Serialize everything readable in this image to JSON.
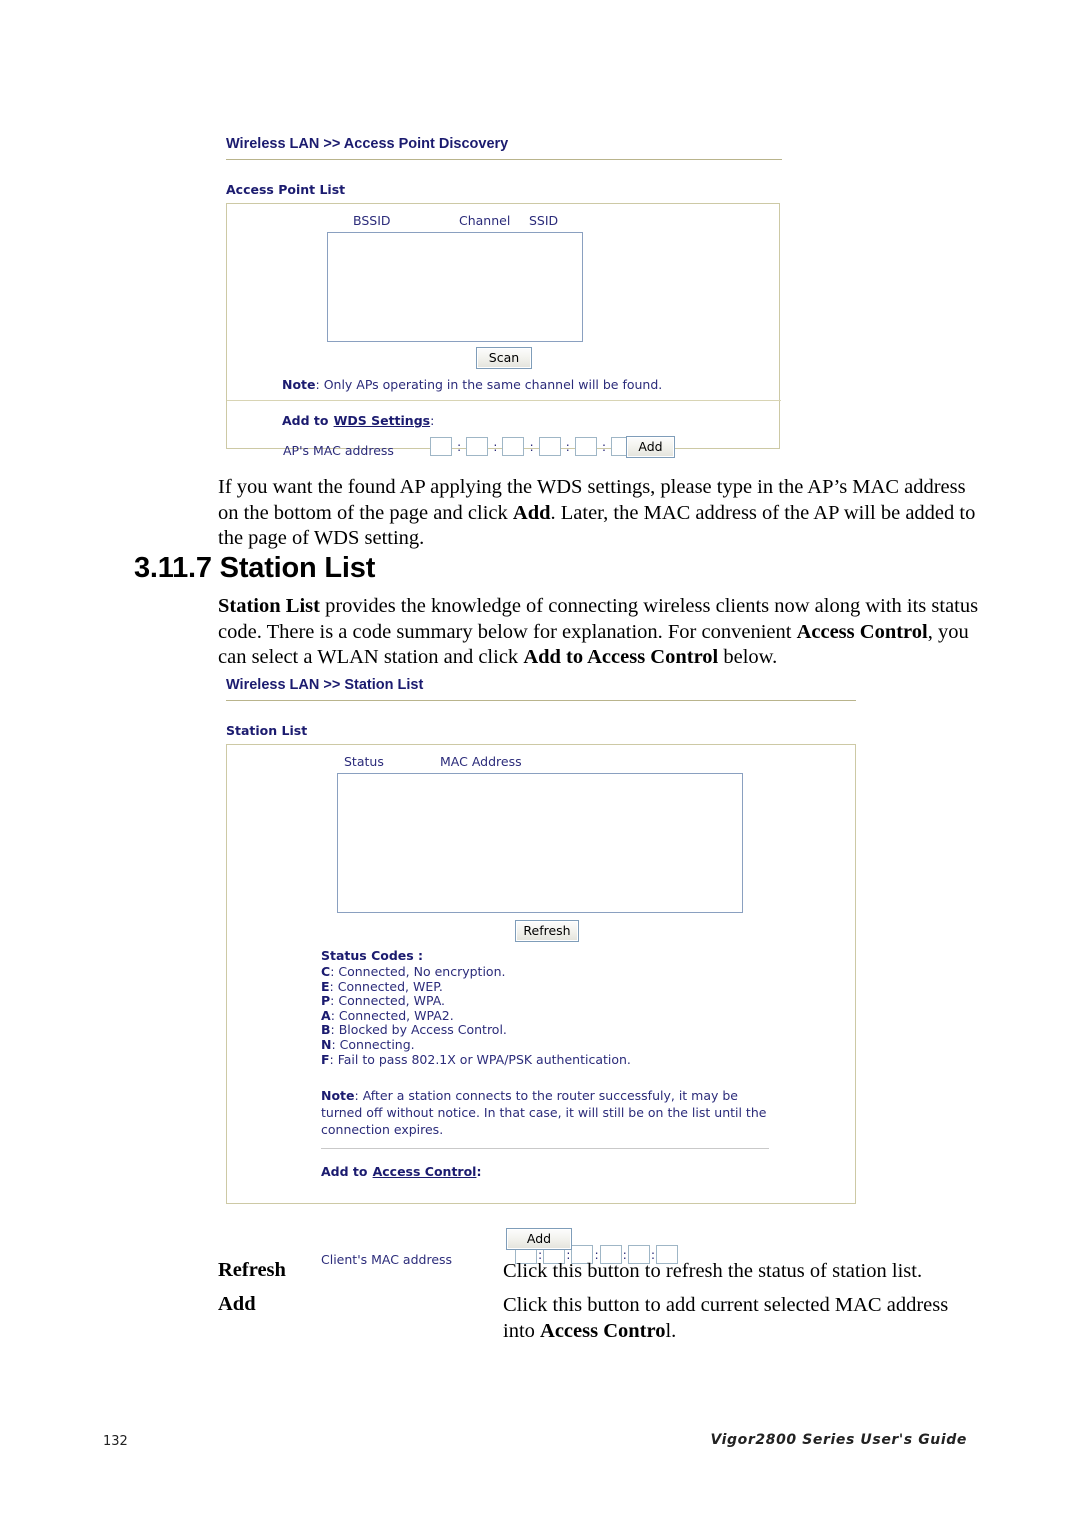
{
  "page": {
    "number": "132",
    "footer_right": "Vigor2800 Series User's Guide"
  },
  "apd_panel": {
    "title": "Wireless LAN >> Access Point Discovery",
    "section_label": "Access Point List",
    "columns": [
      "BSSID",
      "Channel",
      "SSID"
    ],
    "rows": [],
    "scan_button": "Scan",
    "note_prefix": "Note",
    "note_text": ": Only APs operating in the same channel will be found.",
    "add_to_label": "Add to",
    "add_to_link": "WDS Settings",
    "add_to_colon": ":",
    "mac_label": "AP's MAC address",
    "mac_octets": [
      "",
      "",
      "",
      "",
      "",
      ""
    ],
    "mac_separator": ":",
    "add_button": "Add"
  },
  "para_wds": {
    "line1_a": "If you want the found AP applying the WDS settings, please type in the AP’s MAC address",
    "line2_a": "on the bottom of the page and click ",
    "line2_b": "Add",
    "line2_c": ". Later, the MAC address of the AP will be added to",
    "line3_a": "the page of WDS setting."
  },
  "heading": {
    "number": "3.11.7",
    "text": "Station List",
    "full": "3.11.7 Station List"
  },
  "para_station": {
    "b1": "Station List",
    "t1": " provides the knowledge of connecting wireless clients now along with its status",
    "t2": "code. There is a code summary below for explanation. For convenient ",
    "b2": "Access Control",
    "t3": ", you",
    "t4": "can select a WLAN station and click ",
    "b3": "Add to Access Control",
    "t5": " below."
  },
  "station_panel": {
    "title": "Wireless LAN >> Station List",
    "section_label": "Station List",
    "columns": [
      "Status",
      "MAC Address"
    ],
    "rows": [],
    "refresh_button": "Refresh",
    "status_codes_title": "Status Codes :",
    "status_codes": [
      {
        "code": "C",
        "desc": ": Connected, No encryption."
      },
      {
        "code": "E",
        "desc": ": Connected, WEP."
      },
      {
        "code": "P",
        "desc": ": Connected, WPA."
      },
      {
        "code": "A",
        "desc": ": Connected, WPA2."
      },
      {
        "code": "B",
        "desc": ": Blocked by Access Control."
      },
      {
        "code": "N",
        "desc": ": Connecting."
      },
      {
        "code": "F",
        "desc": ": Fail to pass 802.1X or WPA/PSK authentication."
      }
    ],
    "note_prefix": "Note",
    "note_line1": ": After a station connects to the router successfuly, it may be",
    "note_line2": "turned off without notice. In that case, it will still be on the list until the",
    "note_line3": "connection expires.",
    "add_to_label": "Add to",
    "add_to_link": "Access Control",
    "add_to_colon": ":",
    "mac_label": "Client's MAC address",
    "mac_octets": [
      "",
      "",
      "",
      "",
      "",
      ""
    ],
    "mac_separator": ":",
    "add_button": "Add"
  },
  "definitions": [
    {
      "term": "Refresh",
      "desc_line1": "Click this button to refresh the status of station list."
    },
    {
      "term": "Add",
      "desc_line1": "Click this button to add current selected MAC address",
      "desc_line2_a": "into ",
      "desc_line2_b": "Access Contro",
      "desc_line2_c": "l."
    }
  ],
  "colors": {
    "ui_heading_blue": "#1b1b6f",
    "ui_text_blue": "#2b2b7a",
    "panel_border": "#cdc9a5",
    "listbox_border": "#8aa0c0",
    "rule_khaki": "#b9b48c"
  }
}
